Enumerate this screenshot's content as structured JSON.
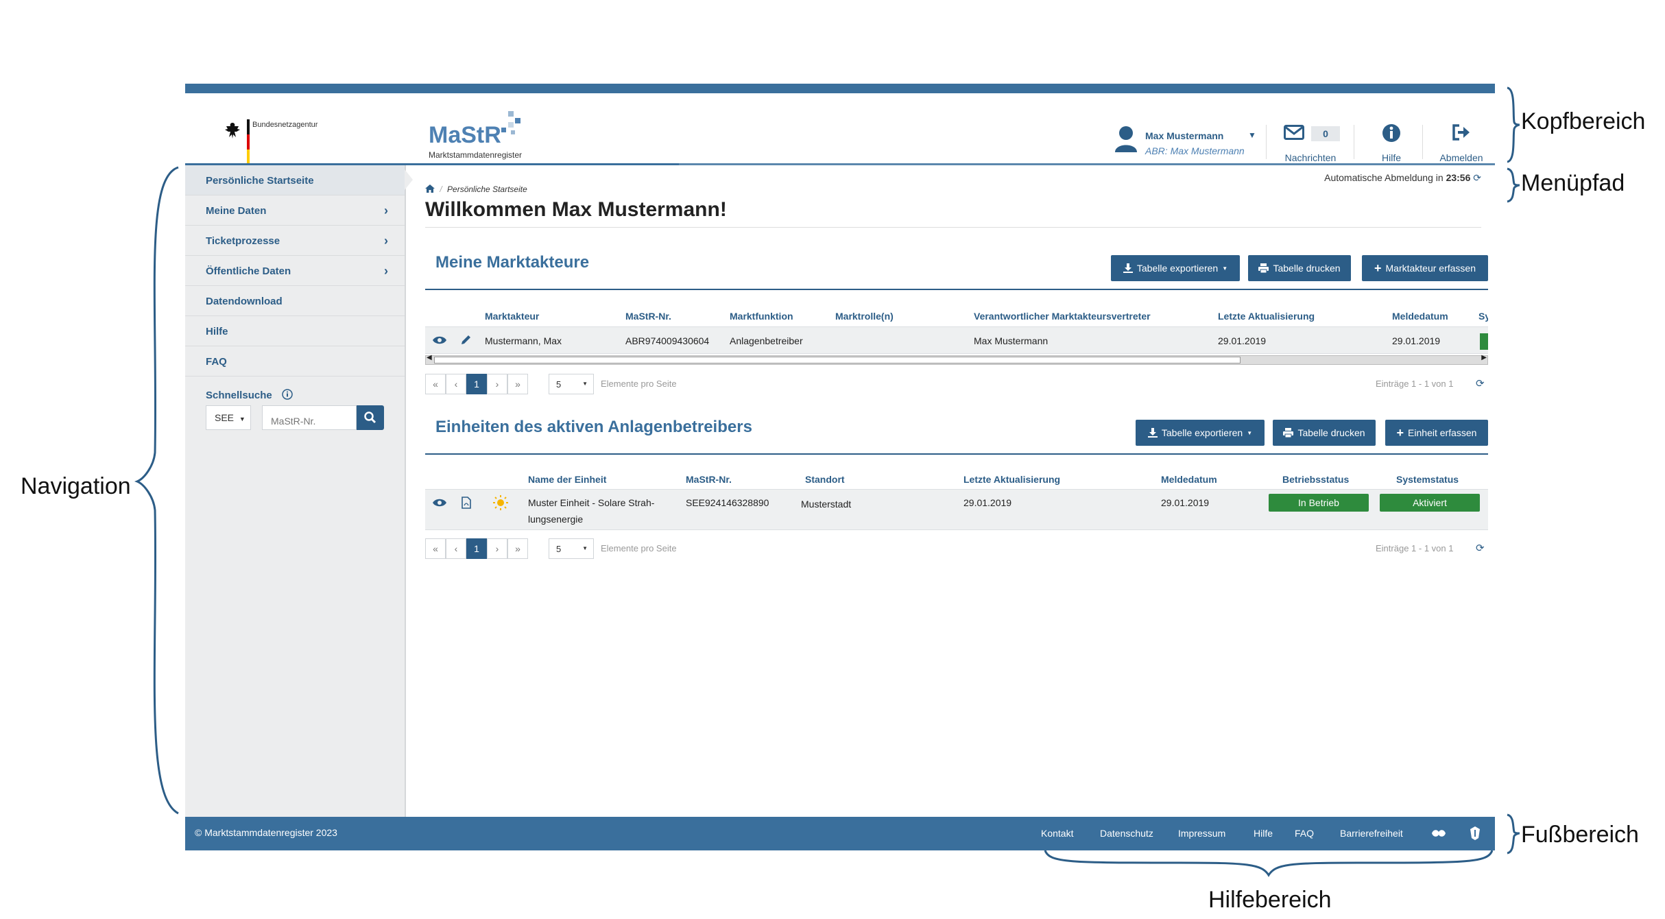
{
  "annotations": {
    "kopfbereich": "Kopfbereich",
    "menuepfad": "Menüpfad",
    "navigation": "Navigation",
    "fussbereich": "Fußbereich",
    "hilfebereich": "Hilfebereich"
  },
  "header": {
    "agency": "Bundesnetzagentur",
    "logo_title": "MaStR",
    "logo_subtitle": "Marktstammdatenregister",
    "user_name": "Max Mustermann",
    "user_abr": "ABR: Max Mustermann",
    "messages_count": "0",
    "messages_label": "Nachrichten",
    "help_label": "Hilfe",
    "logout_label": "Abmelden"
  },
  "sidebar": {
    "items": [
      {
        "label": "Persönliche Startseite",
        "chevron": false
      },
      {
        "label": "Meine Daten",
        "chevron": true
      },
      {
        "label": "Ticketprozesse",
        "chevron": true
      },
      {
        "label": "Öffentliche Daten",
        "chevron": true
      },
      {
        "label": "Datendownload",
        "chevron": false
      },
      {
        "label": "Hilfe",
        "chevron": false
      },
      {
        "label": "FAQ",
        "chevron": false
      }
    ],
    "quick_search_label": "Schnellsuche",
    "quick_search_select": "SEE",
    "quick_search_placeholder": "MaStR-Nr."
  },
  "main": {
    "auto_logout_text": "Automatische Abmeldung in",
    "auto_logout_time": "23:56",
    "breadcrumb": "Persönliche Startseite",
    "welcome": "Willkommen Max Mustermann!",
    "section1": {
      "title": "Meine Marktakteure",
      "btn_export": "Tabelle exportieren",
      "btn_print": "Tabelle drucken",
      "btn_add": "Marktakteur erfassen",
      "columns": [
        "Marktakteur",
        "MaStR-Nr.",
        "Marktfunktion",
        "Marktrolle(n)",
        "Verantwortlicher Marktakteursvertreter",
        "Letzte Aktualisierung",
        "Meldedatum",
        "Sy"
      ],
      "row": [
        "Mustermann, Max",
        "ABR974009430604",
        "Anlagenbetreiber",
        "",
        "Max Mustermann",
        "29.01.2019",
        "29.01.2019"
      ],
      "pager_page": "1",
      "pager_size": "5",
      "pager_caption": "Elemente pro Seite",
      "entries": "Einträge 1 - 1 von 1"
    },
    "section2": {
      "title": "Einheiten des aktiven Anlagenbetreibers",
      "btn_export": "Tabelle exportieren",
      "btn_print": "Tabelle drucken",
      "btn_add": "Einheit erfassen",
      "columns": [
        "Name der Einheit",
        "MaStR-Nr.",
        "Standort",
        "Letzte Aktualisierung",
        "Meldedatum",
        "Betriebsstatus",
        "Systemstatus"
      ],
      "row_name_1": "Muster Einheit - Solare Strah-",
      "row_name_2": "lungsenergie",
      "row": [
        "SEE924146328890",
        "Musterstadt",
        "29.01.2019",
        "29.01.2019"
      ],
      "status_betrieb": "In Betrieb",
      "status_system": "Aktiviert",
      "pager_page": "1",
      "pager_size": "5",
      "pager_caption": "Elemente pro Seite",
      "entries": "Einträge 1 - 1 von 1"
    }
  },
  "footer": {
    "copyright": "© Marktstammdatenregister 2023",
    "links": [
      "Kontakt",
      "Datenschutz",
      "Impressum",
      "Hilfe",
      "FAQ",
      "Barrierefreiheit"
    ]
  },
  "colors": {
    "primary": "#2c5d87",
    "header_bar": "#3a6f9c",
    "status_green": "#2e8b3d",
    "sidebar_bg": "#ecedee"
  }
}
